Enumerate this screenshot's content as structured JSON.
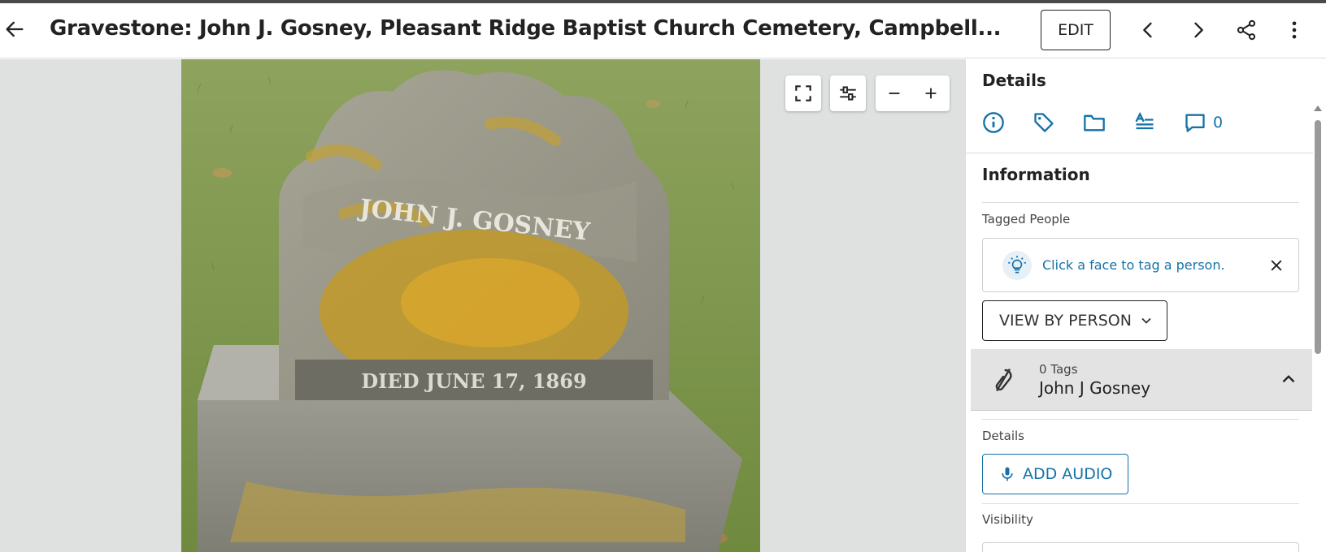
{
  "header": {
    "title": "Gravestone: John J. Gosney, Pleasant Ridge Baptist Church Cemetery, Campbell...",
    "edit_label": "EDIT"
  },
  "icons": {
    "back": "arrow-left-icon",
    "prev": "chevron-left-icon",
    "next": "chevron-right-icon",
    "share": "share-icon",
    "more": "more-vertical-icon",
    "fullscreen": "fullscreen-icon",
    "adjust": "sliders-icon",
    "zoom_out": "minus-icon",
    "zoom_in": "plus-icon"
  },
  "photo": {
    "inscription_name": "JOHN J. GOSNEY",
    "inscription_died": "DIED JUNE 17, 1869"
  },
  "panel": {
    "title": "Details",
    "comment_count": "0",
    "information_title": "Information",
    "tagged_people_label": "Tagged People",
    "hint_text": "Click a face to tag a person.",
    "view_by_person_label": "VIEW BY PERSON",
    "person": {
      "tags": "0 Tags",
      "name": "John J Gosney"
    },
    "details_label": "Details",
    "add_audio_label": "ADD AUDIO",
    "visibility_label": "Visibility"
  },
  "colors": {
    "accent": "#1572a8",
    "viewer_bg": "#dfe1e0",
    "person_row_bg": "#e3e3e3"
  }
}
